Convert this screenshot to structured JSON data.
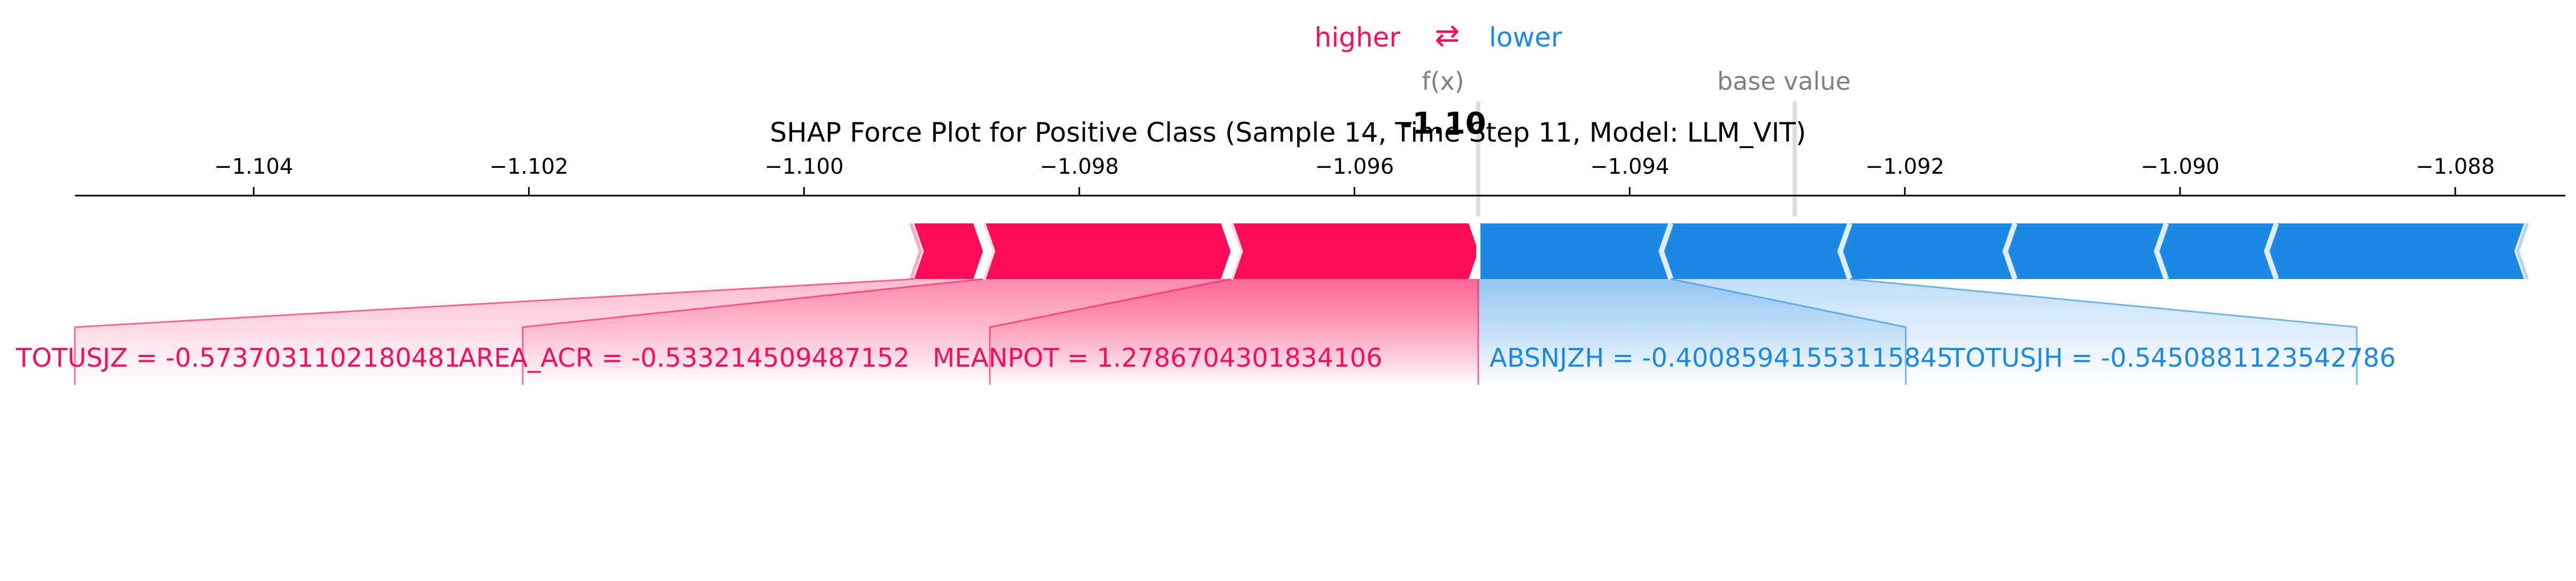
{
  "chart_data": {
    "type": "force",
    "title": "SHAP Force Plot for Positive Class (Sample 14, Time Step 11, Model: LLM_VIT)",
    "legend": {
      "higher": "higher",
      "arrows": "⇄",
      "lower": "lower"
    },
    "fx_label": "f(x)",
    "fx_value": -1.0951,
    "fx_display": "-1.10",
    "base_label": "base value",
    "base_value": -1.0928,
    "xlim": [
      -1.1053,
      -1.0872
    ],
    "ticks": [
      -1.104,
      -1.102,
      -1.1,
      -1.098,
      -1.096,
      -1.094,
      -1.092,
      -1.09,
      -1.088
    ],
    "tick_labels": [
      "−1.104",
      "−1.102",
      "−1.100",
      "−1.098",
      "−1.096",
      "−1.094",
      "−1.092",
      "−1.090",
      "−1.088"
    ],
    "positive_segments": [
      -1.0992,
      -1.0987,
      -1.0969,
      -1.0951
    ],
    "negative_segments": [
      -1.0951,
      -1.0937,
      -1.0924,
      -1.0912,
      -1.0901,
      -1.0893,
      -1.0875
    ],
    "positive_labels": [
      {
        "text": "TOTUSJZ = -0.5737031102180481",
        "segment": 0
      },
      {
        "text": "AREA_ACR = -0.533214509487152",
        "segment": 1
      },
      {
        "text": "MEANPOT = 1.2786704301834106",
        "segment": 2
      }
    ],
    "negative_labels": [
      {
        "text": "ABSNJZH = -0.40085941553115845",
        "segment": 0
      },
      {
        "text": "TOTUSJH = -0.5450881123542786",
        "segment": 1
      }
    ],
    "colors": {
      "positive": "#ff0d57",
      "negative": "#1e88e5",
      "gray": "#808080",
      "text": "#000000"
    }
  }
}
